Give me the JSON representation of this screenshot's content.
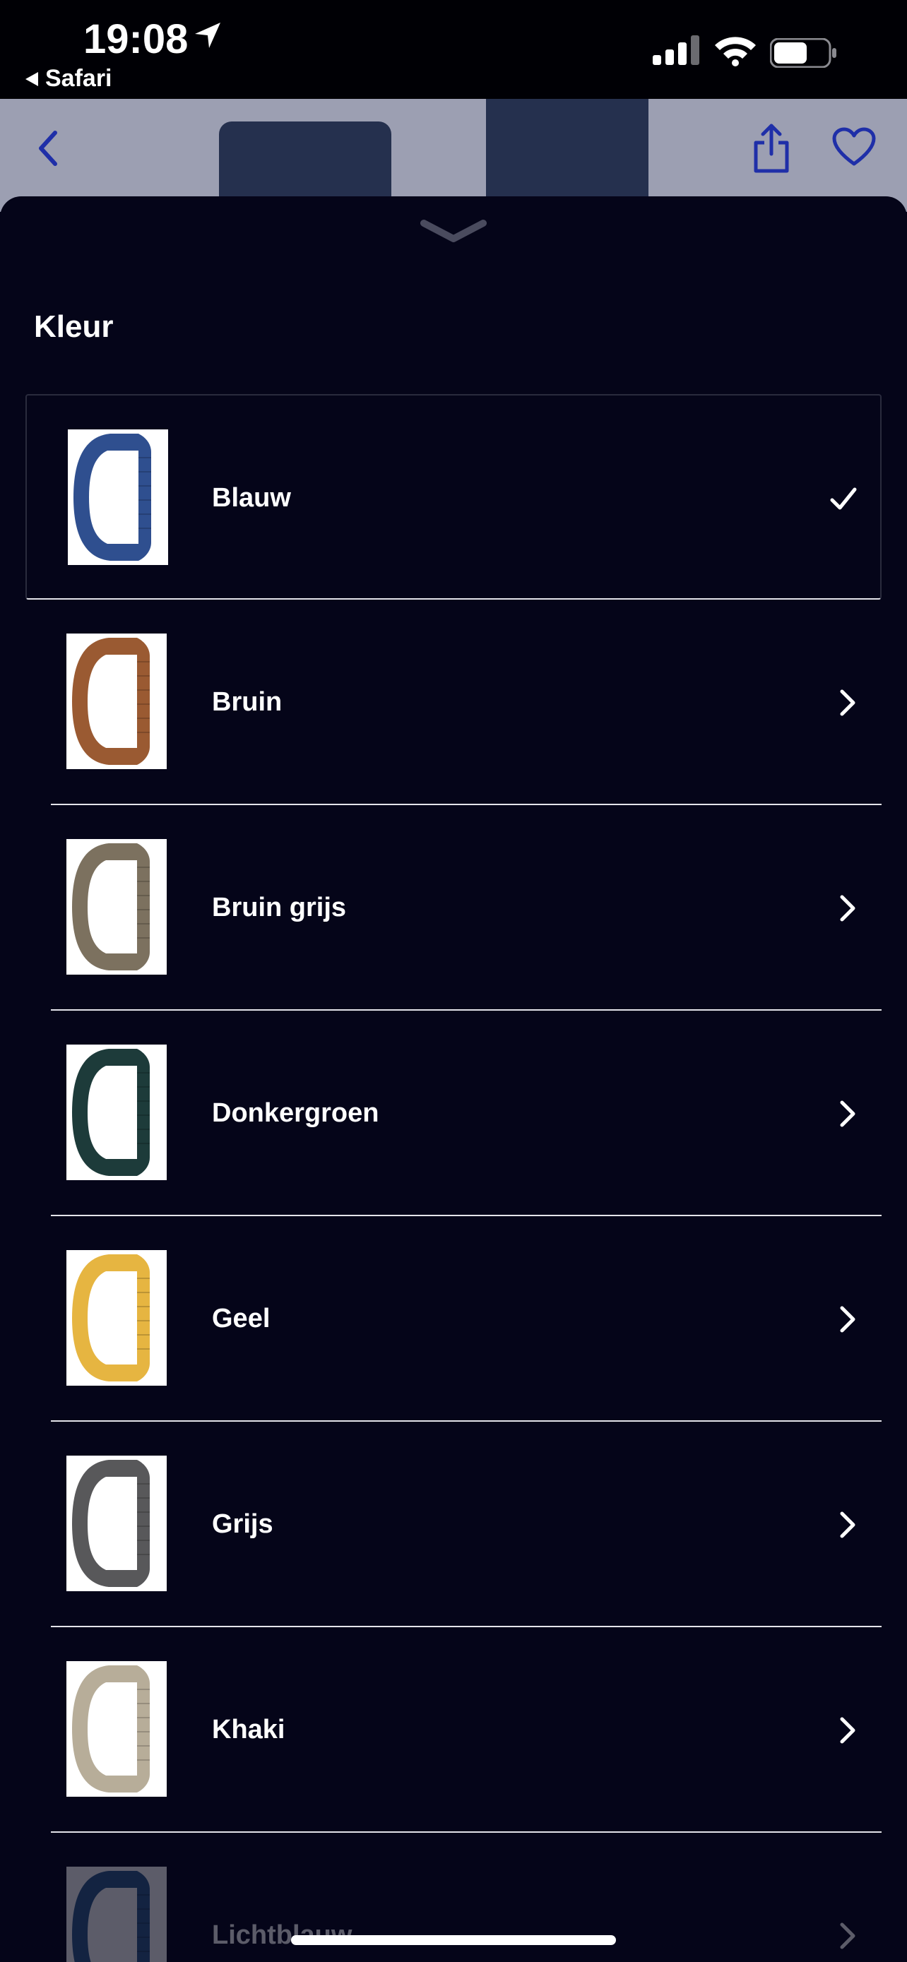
{
  "status_bar": {
    "time": "19:08",
    "back_app": "Safari",
    "icons": [
      "location-arrow-icon",
      "cellular-signal-icon",
      "wifi-icon",
      "battery-icon"
    ]
  },
  "header": {
    "icons": [
      "chevron-left-icon",
      "share-icon",
      "heart-icon"
    ],
    "accent_color": "#1f2fa8"
  },
  "sheet": {
    "title": "Kleur",
    "handle_icon": "chevron-down-icon",
    "items": [
      {
        "label": "Blauw",
        "selected": true,
        "strap_color": "#2f4f8f",
        "trailing_icon": "checkmark-icon"
      },
      {
        "label": "Bruin",
        "selected": false,
        "strap_color": "#9a5a32",
        "trailing_icon": "chevron-right-icon"
      },
      {
        "label": "Bruin grijs",
        "selected": false,
        "strap_color": "#7c715f",
        "trailing_icon": "chevron-right-icon"
      },
      {
        "label": "Donkergroen",
        "selected": false,
        "strap_color": "#1d3b3a",
        "trailing_icon": "chevron-right-icon"
      },
      {
        "label": "Geel",
        "selected": false,
        "strap_color": "#e6b541",
        "trailing_icon": "chevron-right-icon"
      },
      {
        "label": "Grijs",
        "selected": false,
        "strap_color": "#58585a",
        "trailing_icon": "chevron-right-icon"
      },
      {
        "label": "Khaki",
        "selected": false,
        "strap_color": "#b7ad99",
        "trailing_icon": "chevron-right-icon"
      },
      {
        "label": "Lichtblauw",
        "selected": false,
        "strap_color": "#2e5d8c",
        "trailing_icon": "chevron-right-icon"
      }
    ]
  }
}
